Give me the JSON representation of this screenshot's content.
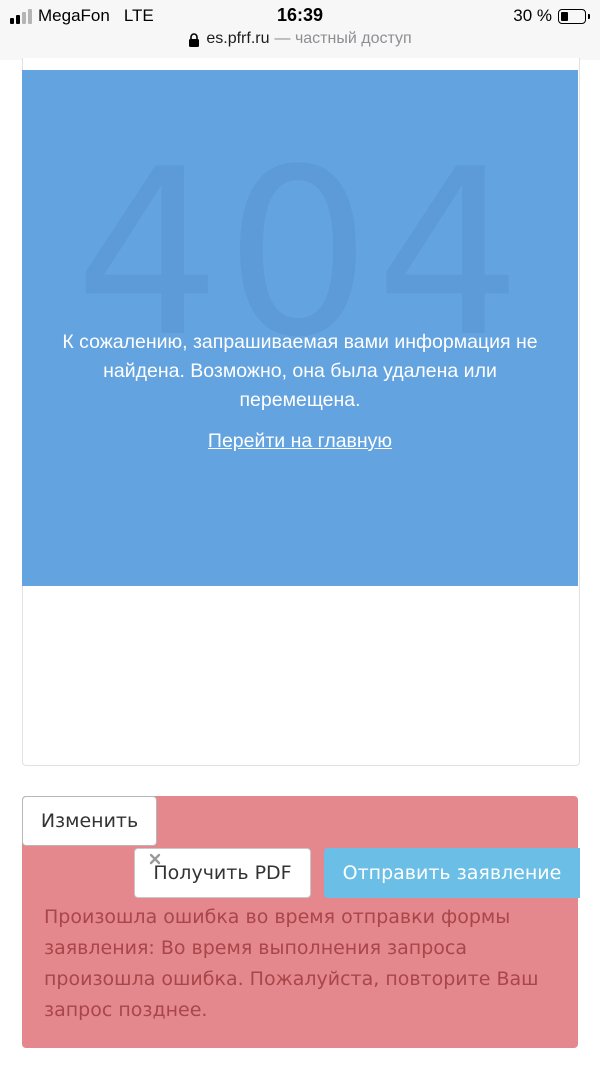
{
  "status_bar": {
    "carrier": "MegaFon",
    "network": "LTE",
    "time": "16:39",
    "battery_percent": "30 %"
  },
  "browser": {
    "domain": "es.pfrf.ru",
    "access_suffix": "— частный доступ"
  },
  "error_page": {
    "code": "404",
    "message": "К сожалению, запрашиваемая вами информация не найдена. Возможно, она была удалена или перемещена.",
    "home_link": "Перейти на главную"
  },
  "form_actions": {
    "edit_label": "Изменить",
    "pdf_label": "Получить PDF",
    "submit_label": "Отправить заявление"
  },
  "alert": {
    "message": "Произошла ошибка во время отправки формы заявления: Во время выполнения запроса произошла ошибка. Пожалуйста, повторите Ваш запрос позднее."
  },
  "colors": {
    "error_panel": "#62a3e0",
    "alert_background": "#e4888e",
    "alert_text": "#a8464a",
    "submit_button": "#6bbfe6"
  },
  "icons": [
    "signal-icon",
    "lock-icon",
    "battery-icon",
    "close-icon"
  ]
}
